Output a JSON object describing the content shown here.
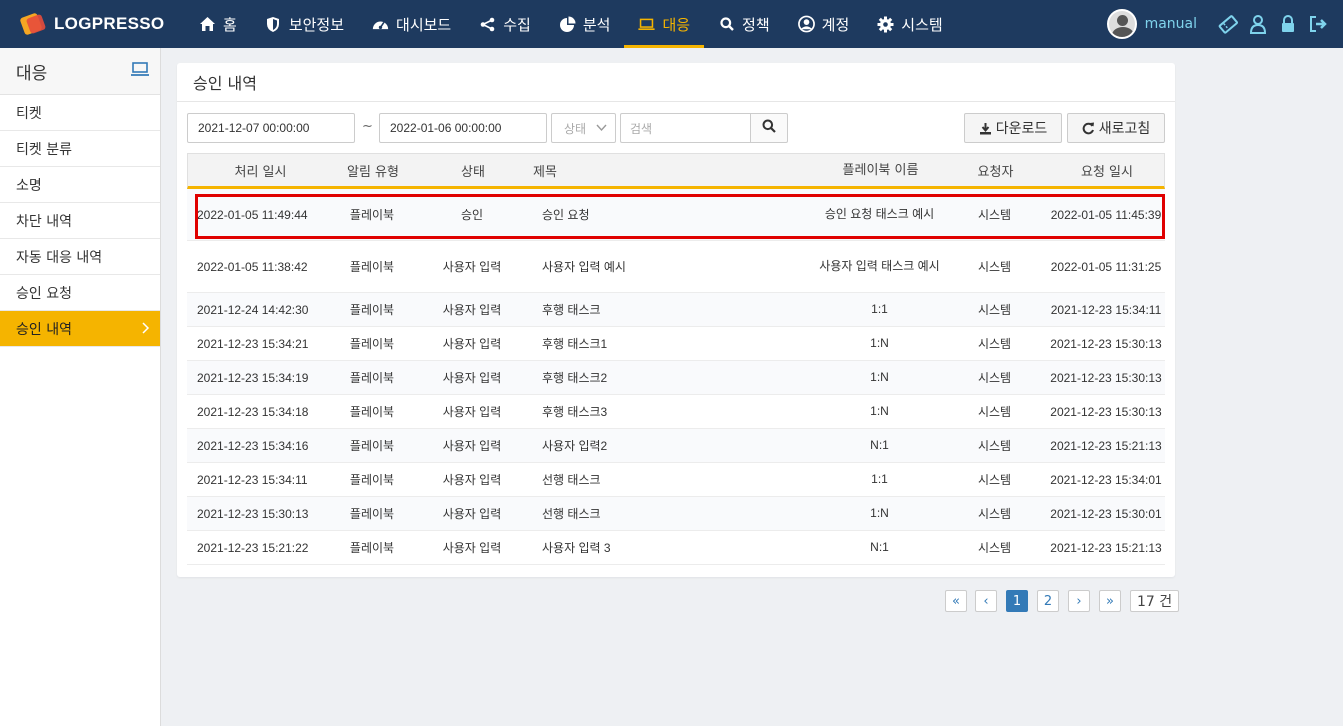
{
  "navbar": {
    "logo_text": "LOGPRESSO",
    "items": [
      {
        "label": "홈",
        "icon": "home-icon"
      },
      {
        "label": "보안정보",
        "icon": "shield-icon"
      },
      {
        "label": "대시보드",
        "icon": "dashboard-icon"
      },
      {
        "label": "수집",
        "icon": "share-icon"
      },
      {
        "label": "분석",
        "icon": "pie-chart-icon"
      },
      {
        "label": "대응",
        "icon": "laptop-icon"
      },
      {
        "label": "정책",
        "icon": "search-icon"
      },
      {
        "label": "계정",
        "icon": "user-circle-icon"
      },
      {
        "label": "시스템",
        "icon": "gear-icon"
      }
    ],
    "active_index": 5,
    "username": "manual",
    "accent": "#f5b400",
    "background": "#1e3a5f"
  },
  "sidebar": {
    "title": "대응",
    "items": [
      {
        "label": "티켓"
      },
      {
        "label": "티켓 분류"
      },
      {
        "label": "소명"
      },
      {
        "label": "차단 내역"
      },
      {
        "label": "자동 대응 내역"
      },
      {
        "label": "승인 요청"
      },
      {
        "label": "승인 내역"
      }
    ],
    "active_index": 6
  },
  "panel": {
    "title": "승인 내역",
    "from_date": "2021-12-07 00:00:00",
    "to_date": "2022-01-06 00:00:00",
    "tilde": "~",
    "status_placeholder": "상태",
    "search_placeholder": "검색",
    "download_label": "다운로드",
    "refresh_label": "새로고침"
  },
  "table": {
    "columns": [
      "처리 일시",
      "알림 유형",
      "상태",
      "제목",
      "플레이북 이름",
      "요청자",
      "요청 일시"
    ],
    "rows": [
      {
        "processed": "2022-01-05 11:49:44",
        "type": "플레이북",
        "status": "승인",
        "title": "승인 요청",
        "playbook": "승인 요청 태스크 예시",
        "requester": "시스템",
        "requested": "2022-01-05 11:45:39"
      },
      {
        "processed": "2022-01-05 11:38:42",
        "type": "플레이북",
        "status": "사용자 입력",
        "title": "사용자 입력 예시",
        "playbook": "사용자 입력 태스크 예시",
        "requester": "시스템",
        "requested": "2022-01-05 11:31:25"
      },
      {
        "processed": "2021-12-24 14:42:30",
        "type": "플레이북",
        "status": "사용자 입력",
        "title": "후행 태스크",
        "playbook": "1:1",
        "requester": "시스템",
        "requested": "2021-12-23 15:34:11"
      },
      {
        "processed": "2021-12-23 15:34:21",
        "type": "플레이북",
        "status": "사용자 입력",
        "title": "후행 태스크1",
        "playbook": "1:N",
        "requester": "시스템",
        "requested": "2021-12-23 15:30:13"
      },
      {
        "processed": "2021-12-23 15:34:19",
        "type": "플레이북",
        "status": "사용자 입력",
        "title": "후행 태스크2",
        "playbook": "1:N",
        "requester": "시스템",
        "requested": "2021-12-23 15:30:13"
      },
      {
        "processed": "2021-12-23 15:34:18",
        "type": "플레이북",
        "status": "사용자 입력",
        "title": "후행 태스크3",
        "playbook": "1:N",
        "requester": "시스템",
        "requested": "2021-12-23 15:30:13"
      },
      {
        "processed": "2021-12-23 15:34:16",
        "type": "플레이북",
        "status": "사용자 입력",
        "title": "사용자 입력2",
        "playbook": "N:1",
        "requester": "시스템",
        "requested": "2021-12-23 15:21:13"
      },
      {
        "processed": "2021-12-23 15:34:11",
        "type": "플레이북",
        "status": "사용자 입력",
        "title": "선행 태스크",
        "playbook": "1:1",
        "requester": "시스템",
        "requested": "2021-12-23 15:34:01"
      },
      {
        "processed": "2021-12-23 15:30:13",
        "type": "플레이북",
        "status": "사용자 입력",
        "title": "선행 태스크",
        "playbook": "1:N",
        "requester": "시스템",
        "requested": "2021-12-23 15:30:01"
      },
      {
        "processed": "2021-12-23 15:21:22",
        "type": "플레이북",
        "status": "사용자 입력",
        "title": "사용자 입력 3",
        "playbook": "N:1",
        "requester": "시스템",
        "requested": "2021-12-23 15:21:13"
      }
    ],
    "highlighted_row_index": 0,
    "highlight_color": "#e00000"
  },
  "pagination": {
    "first": "«",
    "prev": "‹",
    "pages": [
      "1",
      "2"
    ],
    "current_page": "1",
    "next": "›",
    "last": "»",
    "total": "17 건"
  }
}
